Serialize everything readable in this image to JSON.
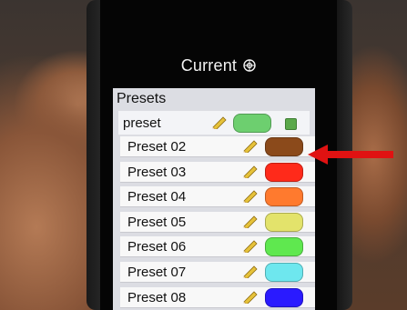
{
  "header": {
    "title": "Current"
  },
  "presets_section": {
    "title": "Presets"
  },
  "current_preset": {
    "name": "preset",
    "color": "#6dcf6f",
    "checked": true
  },
  "presets": [
    {
      "label": "Preset 02",
      "color": "#8b4a1b"
    },
    {
      "label": "Preset 03",
      "color": "#ff2a1a"
    },
    {
      "label": "Preset 04",
      "color": "#ff7a2e"
    },
    {
      "label": "Preset 05",
      "color": "#e3e36b"
    },
    {
      "label": "Preset 06",
      "color": "#5fe84f"
    },
    {
      "label": "Preset 07",
      "color": "#6ee7ee"
    },
    {
      "label": "Preset 08",
      "color": "#2a1aff"
    }
  ],
  "icons": {
    "settings": "gear-icon",
    "edit": "pencil-icon",
    "selected": "checkbox-icon",
    "pointer": "red-arrow-annotation"
  },
  "colors": {
    "annotation": "#e01212",
    "panel": "#dcdde3",
    "screen": "#050505"
  }
}
